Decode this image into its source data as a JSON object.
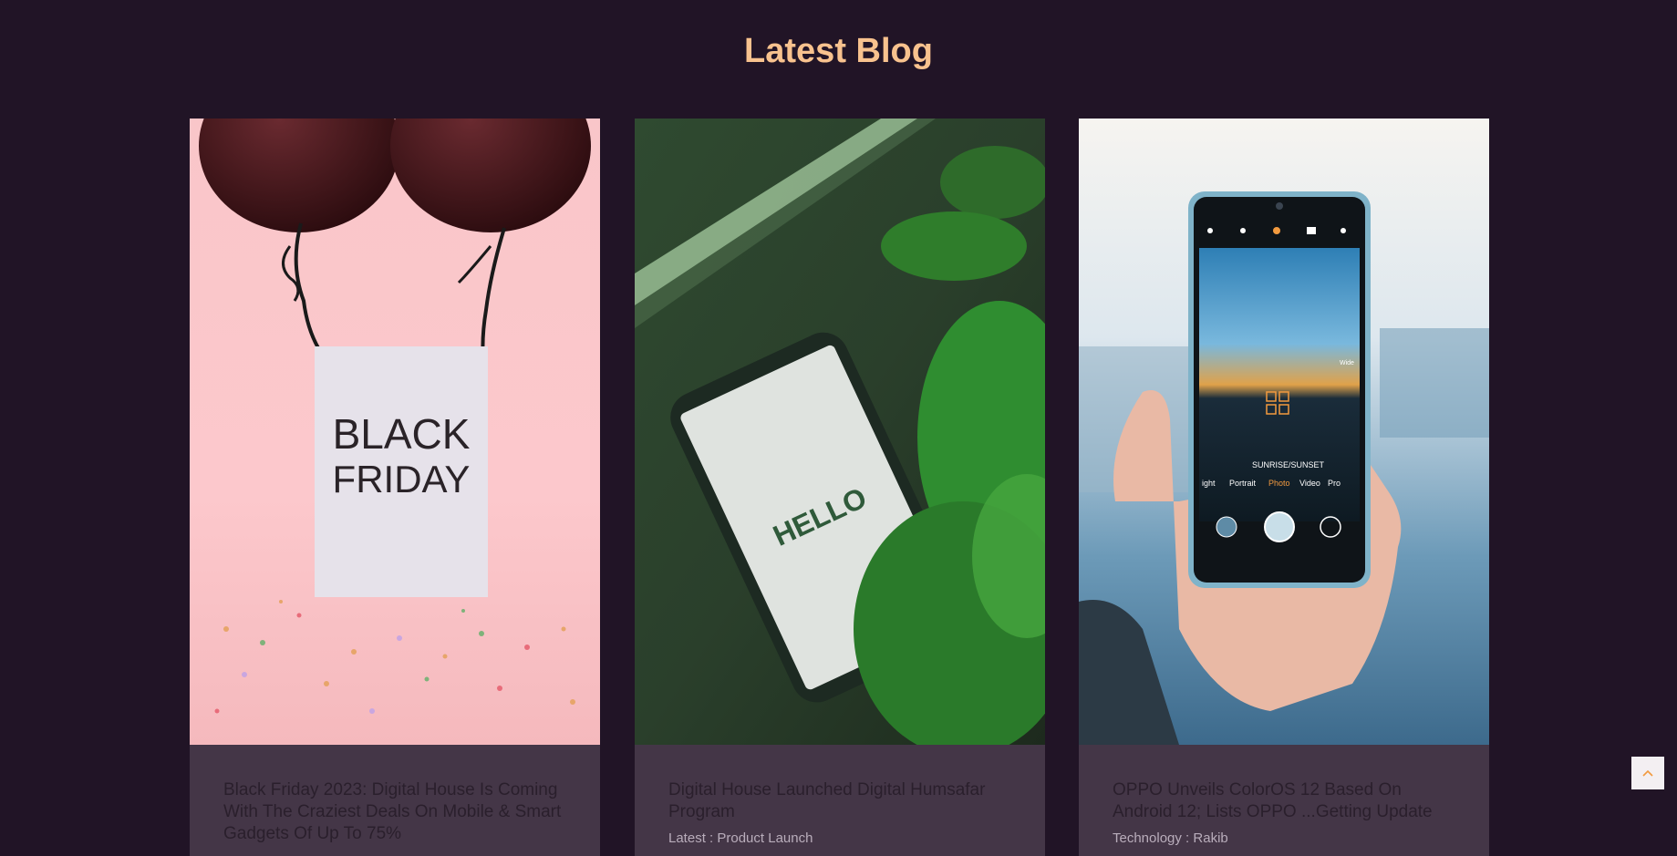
{
  "section": {
    "title": "Latest Blog"
  },
  "posts": [
    {
      "title": "Black Friday 2023: Digital House Is Coming With The Craziest Deals On Mobile & Smart Gadgets Of Up To 75%",
      "meta": "",
      "image_text": [
        "BLACK",
        "FRIDAY"
      ]
    },
    {
      "title": "Digital House Launched Digital Humsafar Program",
      "meta": "Latest : Product Launch",
      "image_text": [
        "HELLO"
      ]
    },
    {
      "title": "OPPO Unveils ColorOS 12 Based On Android 12; Lists OPPO ...Getting Update",
      "meta": "Technology : Rakib",
      "image_text": [
        "SUNRISE/SUNSET",
        "ight",
        "Portrait",
        "Photo",
        "Video",
        "Pro",
        "Wide"
      ]
    }
  ],
  "colors": {
    "page_bg": "#211426",
    "heading": "#f8c28e",
    "card_bg": "#443647",
    "accent": "#f29a3f"
  },
  "icons": {
    "scroll_top": "chevron-up-icon"
  }
}
